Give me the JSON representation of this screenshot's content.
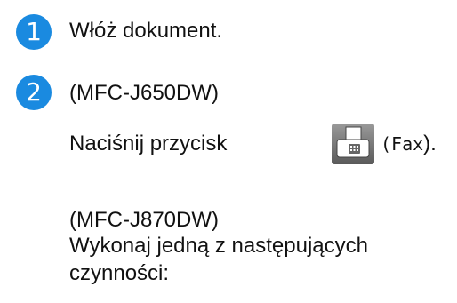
{
  "steps": [
    {
      "number": "1",
      "text": "Włóż dokument."
    },
    {
      "number": "2",
      "model_a": "(MFC-J650DW)",
      "press_text": "Naciśnij przycisk",
      "paren_open": "(",
      "button_name": "Fax",
      "paren_close": ").",
      "model_b": "(MFC-J870DW)",
      "instruction_line1": "Wykonaj jedną z następujących",
      "instruction_line2": "czynności:"
    }
  ],
  "colors": {
    "badge": "#1a8ae0"
  },
  "icons": {
    "fax_button": "fax-icon"
  }
}
